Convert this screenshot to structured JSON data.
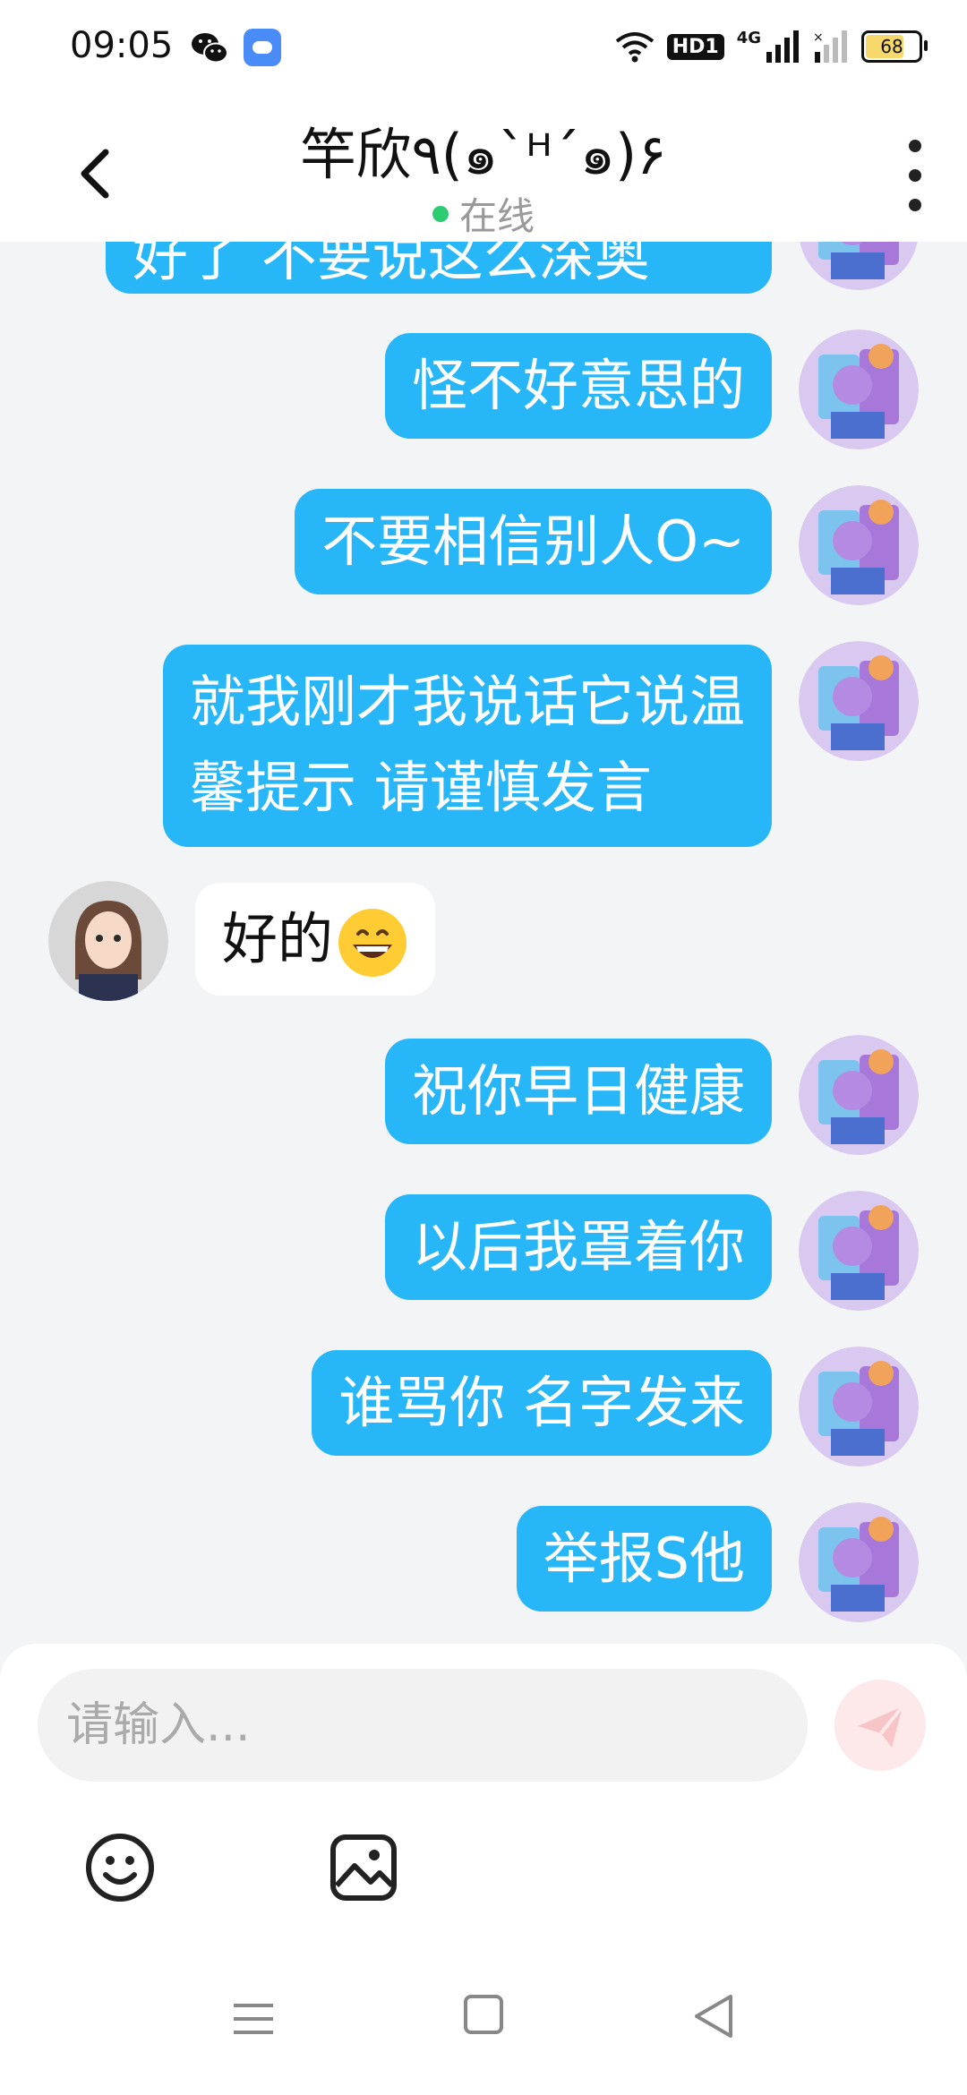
{
  "status_bar": {
    "time": "09:05",
    "network_label": "4G",
    "hd_label": "HD1",
    "battery_level": "68",
    "battery_fill_color": "#f6d86b"
  },
  "header": {
    "title": "竿欣٩(๑`ᴴ´๑)۶",
    "presence": "在线",
    "presence_color": "#2ecc71"
  },
  "messages": [
    {
      "side": "self",
      "text": "好了 不要说这么深奥"
    },
    {
      "side": "self",
      "text": "怪不好意思的"
    },
    {
      "side": "self",
      "text": "不要相信别人O~"
    },
    {
      "side": "self",
      "lines": [
        "就我刚才我说话它说温",
        "馨提示 请谨慎发言"
      ]
    },
    {
      "side": "other",
      "text": "好的",
      "emoji": "grinning-face-icon"
    },
    {
      "side": "self",
      "text": "祝你早日健康"
    },
    {
      "side": "self",
      "text": "以后我罩着你"
    },
    {
      "side": "self",
      "text": "谁骂你 名字发来"
    },
    {
      "side": "self",
      "text": "举报S他"
    }
  ],
  "composer": {
    "placeholder": "请输入...",
    "send_icon": "paper-plane-icon",
    "emoji_icon": "smiley-icon",
    "image_icon": "image-icon"
  },
  "colors": {
    "self_bubble": "#27b6f7",
    "other_bubble": "#ffffff",
    "chat_background": "#f3f4f6"
  }
}
